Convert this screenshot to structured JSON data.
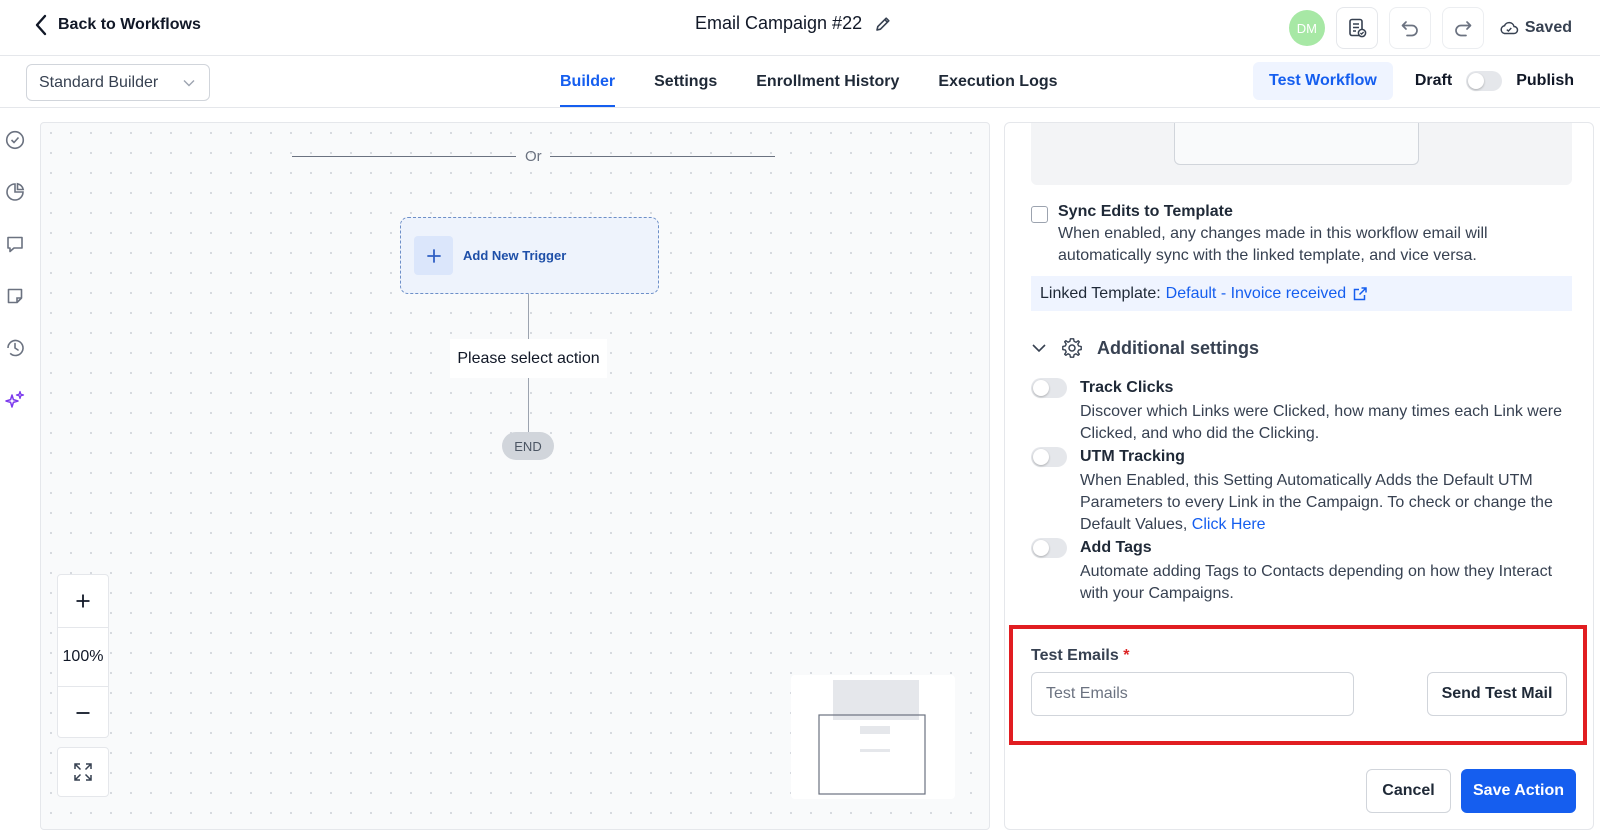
{
  "header": {
    "back_label": "Back to Workflows",
    "title": "Email Campaign #22",
    "avatar_initials": "DM",
    "saved_label": "Saved"
  },
  "subbar": {
    "builder_select": "Standard Builder",
    "tabs": [
      {
        "label": "Builder",
        "active": true
      },
      {
        "label": "Settings",
        "active": false
      },
      {
        "label": "Enrollment History",
        "active": false
      },
      {
        "label": "Execution Logs",
        "active": false
      }
    ],
    "test_workflow": "Test Workflow",
    "draft_label": "Draft",
    "publish_label": "Publish"
  },
  "canvas": {
    "or_label": "Or",
    "add_trigger": "Add New Trigger",
    "action_node": "Please select action",
    "end_node": "END",
    "zoom": "100%"
  },
  "panel": {
    "sync_title": "Sync Edits to Template",
    "sync_desc": "When enabled, any changes made in this workflow email will automatically sync with the linked template, and vice versa.",
    "linked_label": "Linked Template:",
    "linked_value": "Default - Invoice received",
    "additional_settings": "Additional settings",
    "settings": [
      {
        "title": "Track Clicks",
        "desc": "Discover which Links were Clicked, how many times each Link were Clicked, and who did the Clicking."
      },
      {
        "title": "UTM Tracking",
        "desc": "When Enabled, this Setting Automatically Adds the Default UTM Parameters to every Link in the Campaign. To check or change the Default Values,",
        "link": "Click Here"
      },
      {
        "title": "Add Tags",
        "desc": "Automate adding Tags to Contacts depending on how they Interact with your Campaigns."
      }
    ],
    "test_emails_label": "Test Emails",
    "test_emails_required": "*",
    "test_emails_placeholder": "Test Emails",
    "send_test_mail": "Send Test Mail",
    "cancel": "Cancel",
    "save_action": "Save Action"
  },
  "colors": {
    "accent": "#155eef",
    "highlight": "#e11d21",
    "avatar": "#a7e8a5"
  }
}
